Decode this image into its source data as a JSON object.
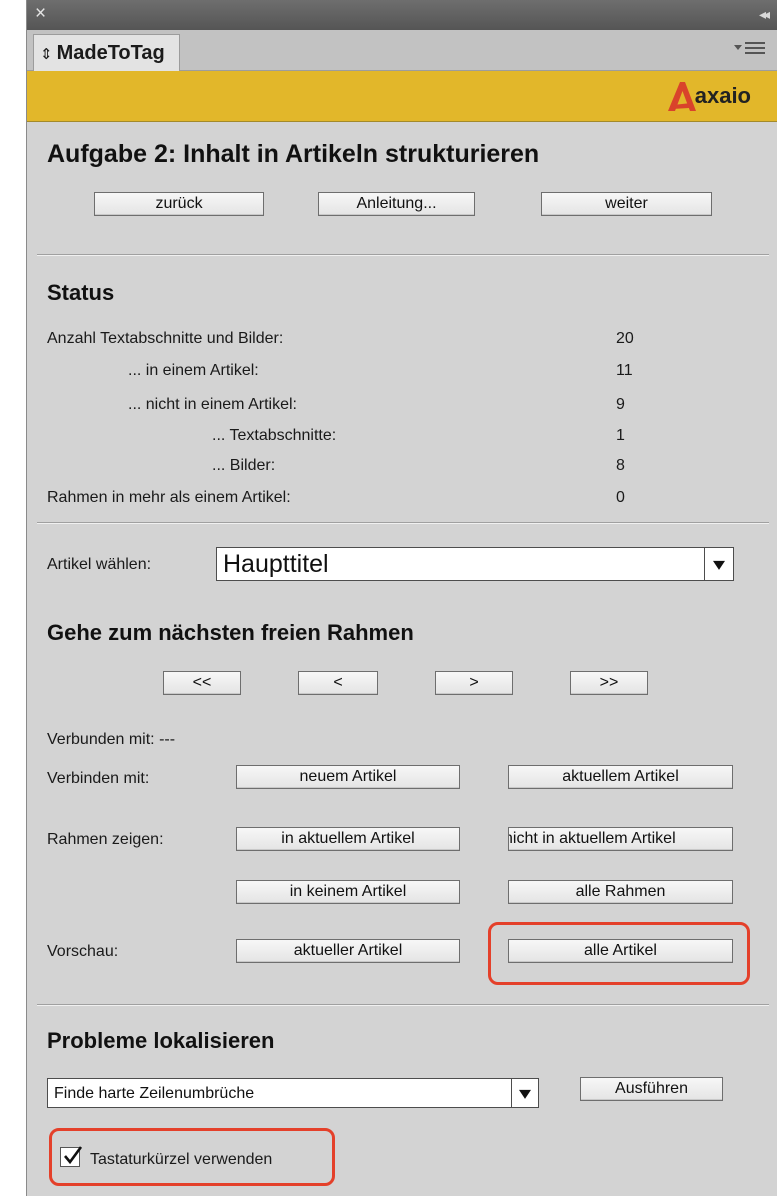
{
  "panel": {
    "tab_label": "MadeToTag",
    "brand": "axaio"
  },
  "task": {
    "title": "Aufgabe 2: Inhalt in Artikeln strukturieren",
    "back_label": "zurück",
    "guide_label": "Anleitung...",
    "next_label": "weiter"
  },
  "status": {
    "heading": "Status",
    "rows": [
      {
        "label": "Anzahl Textabschnitte und Bilder:",
        "value": "20"
      },
      {
        "label": "... in einem Artikel:",
        "value": "11"
      },
      {
        "label": "... nicht in einem Artikel:",
        "value": "9"
      },
      {
        "label": "... Textabschnitte:",
        "value": "1"
      },
      {
        "label": "... Bilder:",
        "value": "8"
      },
      {
        "label": "Rahmen in mehr als einem Artikel:",
        "value": "0"
      }
    ]
  },
  "article": {
    "label": "Artikel wählen:",
    "selected": "Haupttitel"
  },
  "navigation": {
    "heading": "Gehe zum nächsten freien Rahmen",
    "first": "<<",
    "prev": "<",
    "next": ">",
    "last": ">>"
  },
  "connections": {
    "connected_label": "Verbunden mit: ---",
    "connect_label": "Verbinden mit:",
    "new_article": "neuem Artikel",
    "current_article": "aktuellem Artikel"
  },
  "show_frames": {
    "label": "Rahmen zeigen:",
    "in_current": "in aktuellem Artikel",
    "not_in_current": "nicht in aktuellem Artikel",
    "in_none": "in keinem Artikel",
    "all_frames": "alle Rahmen"
  },
  "preview": {
    "label": "Vorschau:",
    "current": "aktueller Artikel",
    "all": "alle Artikel"
  },
  "problems": {
    "heading": "Probleme lokalisieren",
    "selected": "Finde harte Zeilenumbrüche",
    "run_label": "Ausführen",
    "shortcuts_label": "Tastaturkürzel verwenden",
    "shortcuts_checked": true
  },
  "colors": {
    "banner": "#e2b72a",
    "highlight": "#e4402a",
    "logo_red": "#d9432b"
  }
}
